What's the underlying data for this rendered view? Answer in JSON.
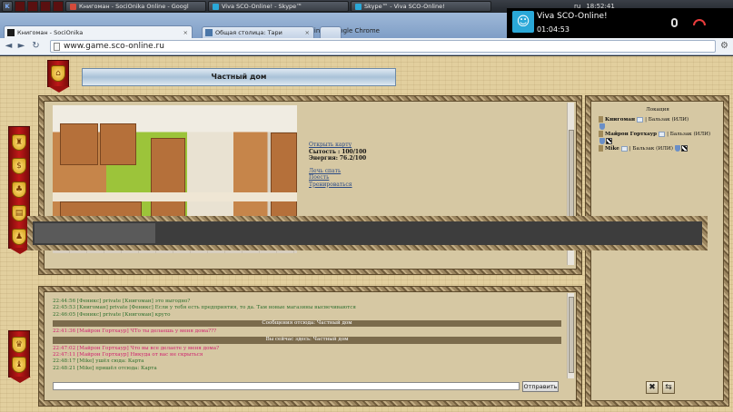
{
  "os": {
    "tasks": [
      {
        "title": "Книгоман - SociOnika Online - Googl",
        "color": "#d44b3b"
      },
      {
        "title": "Viva SCO-Online! - Skype™",
        "color": "#2aa8d8"
      },
      {
        "title": "Skype™ - Viva SCO-Online!",
        "color": "#2aa8d8"
      }
    ],
    "tray": {
      "lang": "ru",
      "clock": "18:52:41"
    }
  },
  "skype_popup": {
    "name": "Viva SCO-Online!",
    "timer": "01:04:53"
  },
  "browser": {
    "window_title": "Книгоман - SociOnika Online - Google Chrome",
    "tabs": [
      {
        "label": "Книгоман - SociOnika",
        "active": true
      },
      {
        "label": "Общая столица: Тари",
        "active": false
      }
    ],
    "url": "www.game.sco-online.ru"
  },
  "game": {
    "location_title": "Частный дом",
    "location_actions": {
      "open_map": "Открыть карту",
      "satiety_label": "Сытость :",
      "satiety_value": "100/100",
      "energy_label": "Энергия:",
      "energy_value": "76.2/100",
      "sleep": "Лечь спать",
      "eat": "Поесть",
      "train": "Тренироваться"
    },
    "loading_progress": 0.18,
    "chat": {
      "messages": [
        {
          "time": "22:44:56",
          "text": "[Феникс] private [Книгоман] это выгодно?",
          "type": "green"
        },
        {
          "time": "22:45:53",
          "text": "[Книгоман] private [Феникс] Если у тебя есть предприятия, то да. Там новые магазины высвечиваются",
          "type": "green"
        },
        {
          "time": "22:46:05",
          "text": "[Феникс] private [Книгоман] круто",
          "type": "green"
        },
        {
          "time": "",
          "text": "Сообщения отсюда: Частный дом",
          "type": "sys"
        },
        {
          "time": "22:41:36",
          "text": "[Майрон Гортхаур] ЧТо ты делаешь у меня дома???",
          "type": "pink"
        },
        {
          "time": "",
          "text": "Вы сейчас здесь: Частный дом",
          "type": "sys"
        },
        {
          "time": "22:47:02",
          "text": "[Майрон Гортхаур] Что вы все делаете у меня дома?",
          "type": "pink"
        },
        {
          "time": "22:47:11",
          "text": "[Майрон Гортхаур] Никуда от вас не скрыться",
          "type": "pink"
        },
        {
          "time": "22:48:17",
          "text": "[Mike] ушёл сюда: Карта",
          "type": "green"
        },
        {
          "time": "22:48:21",
          "text": "[Mike] пришёл отсюда: Карта",
          "type": "green"
        }
      ],
      "input_value": "",
      "send_label": "Отправить"
    },
    "location_panel": {
      "header": "Локация",
      "players": [
        {
          "name": "Книгоман",
          "info": "| Бальзак (ИЛИ)"
        },
        {
          "name": "Майрон Гортхаур",
          "info": "| Бальзак (ИЛИ)"
        },
        {
          "name": "Mike",
          "info": "| Бальзак (ИЛИ)"
        }
      ]
    }
  }
}
